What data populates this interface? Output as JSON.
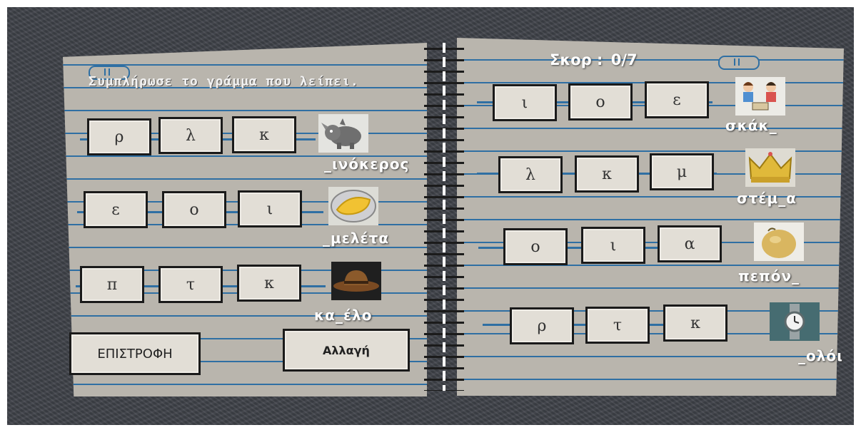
{
  "instruction": "Συμπλήρωσε το γράμμα που λείπει.",
  "score": {
    "label": "Σκορ :",
    "value": "0/7"
  },
  "buttons": {
    "back": "ΕΠΙΣΤΡΟΦΗ",
    "change": "Αλλαγή"
  },
  "left_items": [
    {
      "letters": [
        "ρ",
        "λ",
        "κ"
      ],
      "word": "_ινόκερος",
      "picture": "rhino-icon"
    },
    {
      "letters": [
        "ε",
        "ο",
        "ι"
      ],
      "word": "_μελέτα",
      "picture": "omelette-icon"
    },
    {
      "letters": [
        "π",
        "τ",
        "κ"
      ],
      "word": "κα_έλο",
      "picture": "hat-icon"
    }
  ],
  "right_items": [
    {
      "letters": [
        "ι",
        "ο",
        "ε"
      ],
      "word": "σκάκ_",
      "picture": "chess-kids-icon"
    },
    {
      "letters": [
        "λ",
        "κ",
        "μ"
      ],
      "word": "στέμ_α",
      "picture": "crown-icon"
    },
    {
      "letters": [
        "ο",
        "ι",
        "α"
      ],
      "word": "πεπόν_",
      "picture": "melon-icon"
    },
    {
      "letters": [
        "ρ",
        "τ",
        "κ"
      ],
      "word": "_ολόι",
      "picture": "watch-icon"
    }
  ]
}
